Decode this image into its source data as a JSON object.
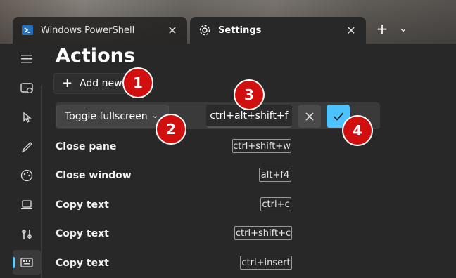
{
  "tabs": [
    {
      "label": "Windows PowerShell",
      "icon": "powershell-icon"
    },
    {
      "label": "Settings",
      "icon": "gear-icon"
    }
  ],
  "tab_add_symbol": "+",
  "page_title": "Actions",
  "add_new_label": "Add new",
  "editor": {
    "action_value": "Toggle fullscreen",
    "keys_value": "ctrl+alt+shift+f"
  },
  "actions": [
    {
      "name": "Close pane",
      "keys": "ctrl+shift+w"
    },
    {
      "name": "Close window",
      "keys": "alt+f4"
    },
    {
      "name": "Copy text",
      "keys": "ctrl+c"
    },
    {
      "name": "Copy text",
      "keys": "ctrl+shift+c"
    },
    {
      "name": "Copy text",
      "keys": "ctrl+insert"
    }
  ],
  "markers": [
    "1",
    "2",
    "3",
    "4"
  ],
  "colors": {
    "accent": "#4cc2ff",
    "marker": "#d20f0f"
  }
}
